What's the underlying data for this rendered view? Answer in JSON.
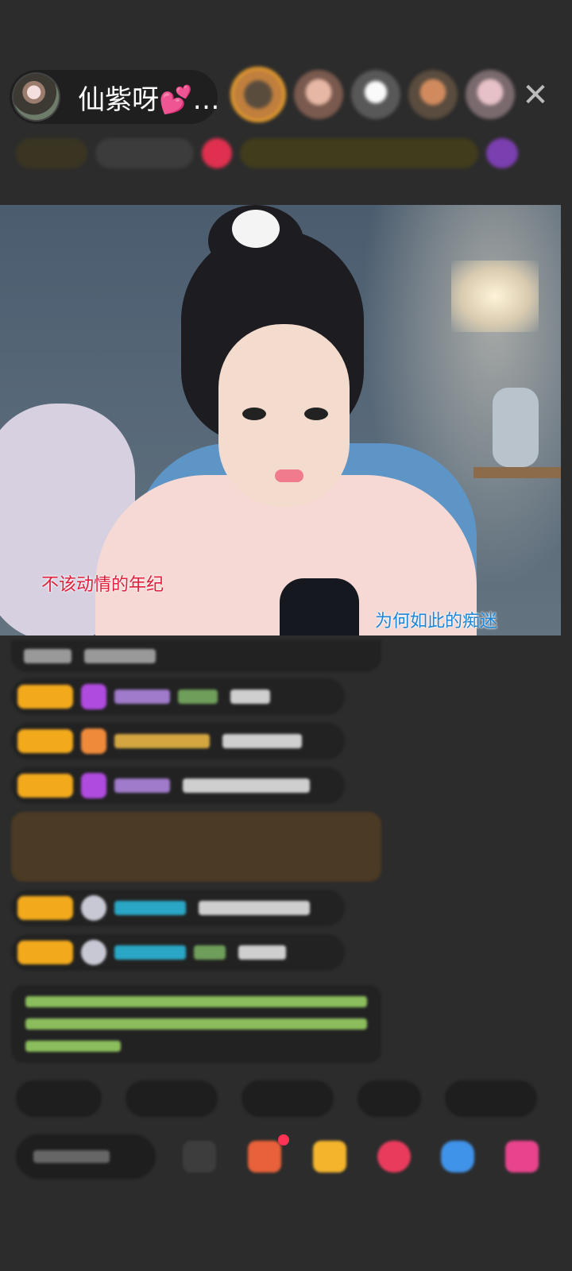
{
  "header": {
    "host_name": "仙紫呀💕…",
    "viewer_avatars": [
      "viewer-avatar-1",
      "viewer-avatar-2",
      "viewer-avatar-3",
      "viewer-avatar-4",
      "viewer-avatar-5"
    ],
    "close_glyph": "✕"
  },
  "stream": {
    "lyric_left": "不该动情的年纪",
    "lyric_right": "为何如此的痴迷"
  },
  "colors": {
    "background": "#2c2c2c",
    "badge": "#f2a91c",
    "lyric_left": "#e11f3b",
    "lyric_right": "#1e86d6"
  }
}
